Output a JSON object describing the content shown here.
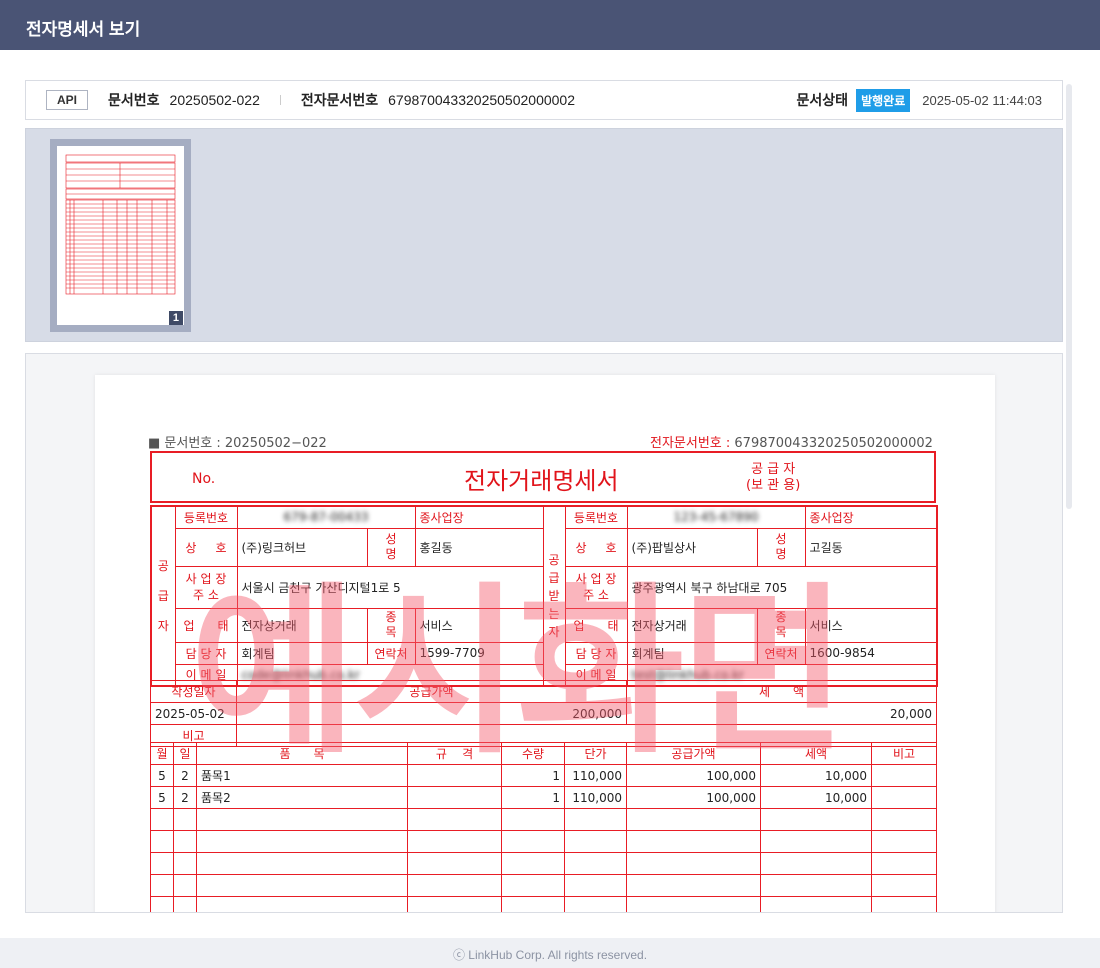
{
  "window": {
    "title": "전자명세서 보기"
  },
  "info": {
    "api_label": "API",
    "doc_no_label": "문서번호",
    "doc_no": "20250502-022",
    "edoc_no_label": "전자문서번호",
    "edoc_no": "679870043320250502000002",
    "status_label": "문서상태",
    "status": "발행완료",
    "datetime": "2025-05-02 11:44:03"
  },
  "thumb": {
    "page_num": "1"
  },
  "doc": {
    "hdr_left": "■ 문서번호 : 20250502−022",
    "hdr_right_label": "전자문서번호 : ",
    "hdr_right_value": "679870043320250502000002",
    "no_label": "No.",
    "title": "전자거래명세서",
    "copy_line1": "공 급 자",
    "copy_line2": "(보 관 용)",
    "supplier_side": "공\n급\n자",
    "receiver_side": "공\n급\n받\n는\n자",
    "labels": {
      "reg_no": "등록번호",
      "branch": "종사업장",
      "company": "상     호",
      "name": "성\n명",
      "addr": "사 업 장\n주      소",
      "biz_type": "업      태",
      "item_kind": "종\n목",
      "manager": "담 당 자",
      "phone": "연락처",
      "email": "이 메 일",
      "write_date": "작성일자",
      "supply_amount": "공급가액",
      "tax": "세      액",
      "remark": "비고"
    },
    "supplier": {
      "reg_no": "679-87-00433",
      "company": "(주)링크허브",
      "ceo": "홍길동",
      "addr": "서울시 금천구 가산디지털1로 5",
      "biz_type": "전자상거래",
      "item": "서비스",
      "manager": "회계팀",
      "phone": "1599-7709",
      "email": "code@linkhub.co.kr"
    },
    "receiver": {
      "reg_no": "123-45-67890",
      "company": "(주)팝빌상사",
      "ceo": "고길동",
      "addr": "광주광역시 북구 하남대로 705",
      "biz_type": "전자상거래",
      "item": "서비스",
      "manager": "회계팀",
      "phone": "1600-9854",
      "email": "test@linkhub.co.kr"
    },
    "summary": {
      "write_date": "2025-05-02",
      "supply_amount": "200,000",
      "tax": "20,000"
    },
    "item_headers": [
      "월",
      "일",
      "품      목",
      "규    격",
      "수량",
      "단가",
      "공급가액",
      "세액",
      "비고"
    ],
    "items": [
      [
        "5",
        "2",
        "품목1",
        "",
        "1",
        "110,000",
        "100,000",
        "10,000",
        ""
      ],
      [
        "5",
        "2",
        "품목2",
        "",
        "1",
        "110,000",
        "100,000",
        "10,000",
        ""
      ]
    ],
    "watermark": "예시화면"
  },
  "footer": {
    "copyright": "ⓒ LinkHub Corp. All rights reserved."
  }
}
